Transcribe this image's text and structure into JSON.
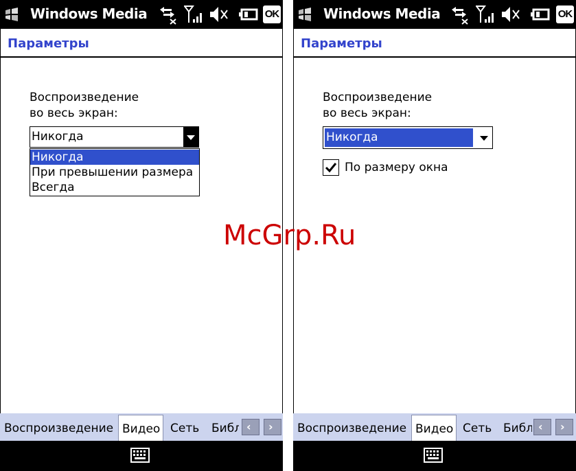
{
  "watermark": "McGrp.Ru",
  "left": {
    "app_title": "Windows Media",
    "ok_label": "OK",
    "header_title": "Параметры",
    "fullscreen_label_line1": "Воспроизведение",
    "fullscreen_label_line2": "во весь экран:",
    "combo_value": "Никогда",
    "dropdown_options": [
      "Никогда",
      "При превышении размера",
      "Всегда"
    ],
    "dropdown_selected": 0,
    "tabs": [
      "Воспроизведение",
      "Видео",
      "Сеть",
      "Библ"
    ],
    "active_tab": 1
  },
  "right": {
    "app_title": "Windows Media",
    "ok_label": "OK",
    "header_title": "Параметры",
    "fullscreen_label_line1": "Воспроизведение",
    "fullscreen_label_line2": "во весь экран:",
    "combo_value": "Никогда",
    "checkbox_label": "По размеру окна",
    "checkbox_checked": true,
    "tabs": [
      "Воспроизведение",
      "Видео",
      "Сеть",
      "Библ"
    ],
    "active_tab": 1
  },
  "colors": {
    "header_title": "#3344cc",
    "selection": "#3050cc",
    "tabbar": "#ccd4ee",
    "watermark": "#cc0000"
  },
  "icons": {
    "start": "windows-flag-icon",
    "connectivity": "connectivity-arrows-icon",
    "signal": "signal-strength-icon",
    "volume": "speaker-muted-icon",
    "battery": "battery-icon",
    "keyboard": "keyboard-icon",
    "tab_prev": "chevron-left-icon",
    "tab_next": "chevron-right-icon"
  }
}
